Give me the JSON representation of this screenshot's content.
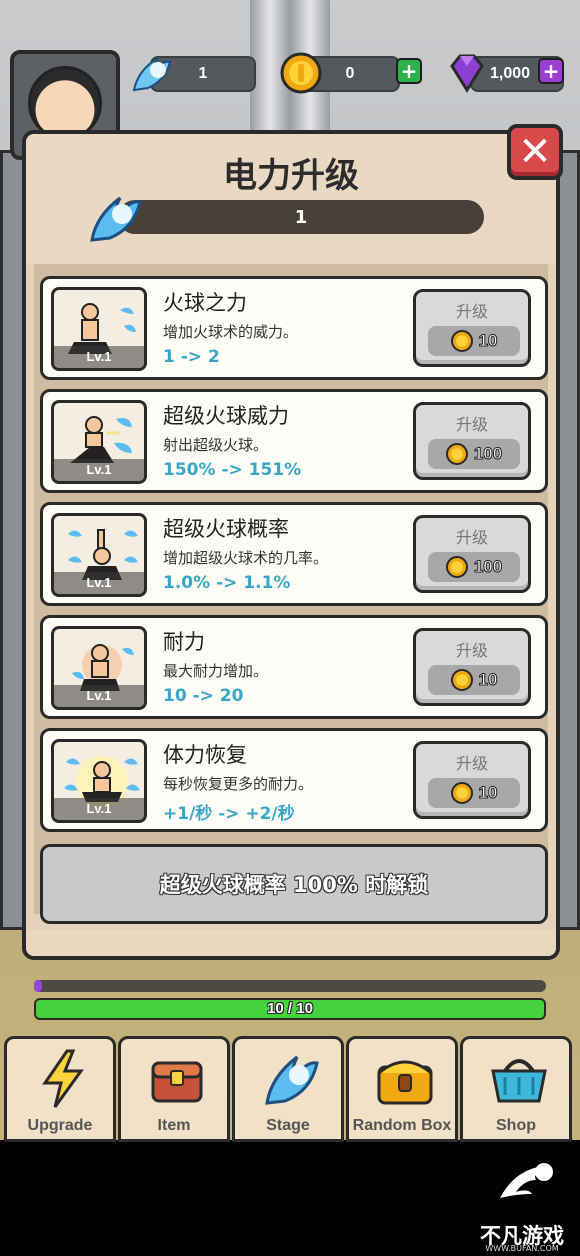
{
  "hud": {
    "power_count": "1",
    "coin_count": "0",
    "gem_count": "1,000",
    "plus_icon": "plus-icon",
    "colors": {
      "coin_plus": "#2bb24c",
      "gem_plus": "#9b3fd4"
    }
  },
  "modal": {
    "title": "电力升级",
    "power_level": "1",
    "close_icon": "close-icon"
  },
  "skills": [
    {
      "name": "火球之力",
      "desc": "增加火球术的威力。",
      "stat": "1 -> 2",
      "level": "Lv.1",
      "button": "升级",
      "price": "10"
    },
    {
      "name": "超级火球威力",
      "desc": "射出超级火球。",
      "stat": "150% -> 151%",
      "level": "Lv.1",
      "button": "升级",
      "price": "100"
    },
    {
      "name": "超级火球概率",
      "desc": "增加超级火球术的几率。",
      "stat": "1.0% -> 1.1%",
      "level": "Lv.1",
      "button": "升级",
      "price": "100"
    },
    {
      "name": "耐力",
      "desc": "最大耐力增加。",
      "stat": "10 -> 20",
      "level": "Lv.1",
      "button": "升级",
      "price": "10"
    },
    {
      "name": "体力恢复",
      "desc": "每秒恢复更多的耐力。",
      "stat": "+1/秒 -> +2/秒",
      "level": "Lv.1",
      "button": "升级",
      "price": "10"
    }
  ],
  "unlock_notice": "超级火球概率 100% 时解锁",
  "progress": {
    "hp_text": "10 / 10",
    "hp_fraction": 1.0
  },
  "nav": [
    {
      "label": "Upgrade",
      "icon": "lightning-icon"
    },
    {
      "label": "Item",
      "icon": "chest-icon"
    },
    {
      "label": "Stage",
      "icon": "fireball-icon"
    },
    {
      "label": "Random Box",
      "icon": "treasure-icon"
    },
    {
      "label": "Shop",
      "icon": "basket-icon"
    }
  ],
  "watermark": {
    "text": "不凡游戏网",
    "sub": "WWW.BUFAN.COM"
  }
}
